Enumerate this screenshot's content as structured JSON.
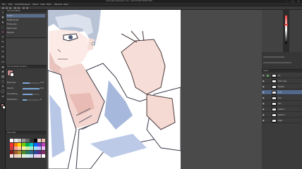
{
  "window": {
    "title": "character illustration.clip - CLIP STUDIO PAINT PRO"
  },
  "menu": {
    "items": [
      "File",
      "Edit",
      "Animation",
      "Layer",
      "Select",
      "View",
      "Filter",
      "Window",
      "Help"
    ]
  },
  "subtool_panel": {
    "header": "Sub Tool [Pen]",
    "items": [
      "G-pen",
      "Mapping pen",
      "Turnip pen",
      "Real G-pen",
      "Felt pen"
    ],
    "selected_index": 0
  },
  "tool_property": {
    "header": "Tool property [G-pen]",
    "sliders": [
      {
        "label": "Brush Size",
        "value": "12.0",
        "level": 0.4
      },
      {
        "label": "Opacity",
        "value": "100",
        "level": 1.0
      },
      {
        "label": "Anti-aliasing",
        "value": "",
        "level": 0.6
      },
      {
        "label": "Stabilization",
        "value": "6",
        "level": 0.25
      }
    ]
  },
  "color": {
    "main": "#c28a8a",
    "sub": "#ffffff",
    "accent": "#5a6e8a"
  },
  "color_set": {
    "header": "Color Set",
    "swatches": [
      "#ffffff",
      "#e6e6e6",
      "#cccccc",
      "#999999",
      "#666666",
      "#333333",
      "#000000",
      "#f2d6c9",
      "#e8b8a8",
      "#ff3030",
      "#ff7a00",
      "#ffd400",
      "#7ad000",
      "#00b050",
      "#00c8c8",
      "#0070ff",
      "#6040d0",
      "#c040c0",
      "#d83a3a",
      "#ff9b9b",
      "#ffcc99",
      "#fff3a0",
      "#c9f0a0",
      "#a0f0d0",
      "#a0e0ff",
      "#c0c0ff",
      "#f0c0ff",
      "#8a1c1c",
      "#a05a2a",
      "#b0902a",
      "#4a8a2a",
      "#2a7a5a",
      "#2a6a8a",
      "#2a4a9a",
      "#5a2a8a",
      "#8a2a6a",
      "#f5e0e0",
      "#f0d0c0",
      "#eadcc0",
      "#e0f0d0",
      "#d0ecec",
      "#d0dcf0",
      "#e0d0f0",
      "#f0d0e8",
      "#ffffff"
    ]
  },
  "layers": {
    "header": "Layer",
    "items": [
      {
        "name": "Ink",
        "selected": false
      },
      {
        "name": "Color copy",
        "selected": false
      },
      {
        "name": "Shadow",
        "selected": false
      },
      {
        "name": "Shirt",
        "selected": true
      },
      {
        "name": "Skin",
        "selected": false
      },
      {
        "name": "Hair",
        "selected": false
      },
      {
        "name": "Sketch 1",
        "selected": false
      },
      {
        "name": "Sketch 2",
        "selected": false
      },
      {
        "name": "Paper",
        "selected": false
      }
    ]
  }
}
